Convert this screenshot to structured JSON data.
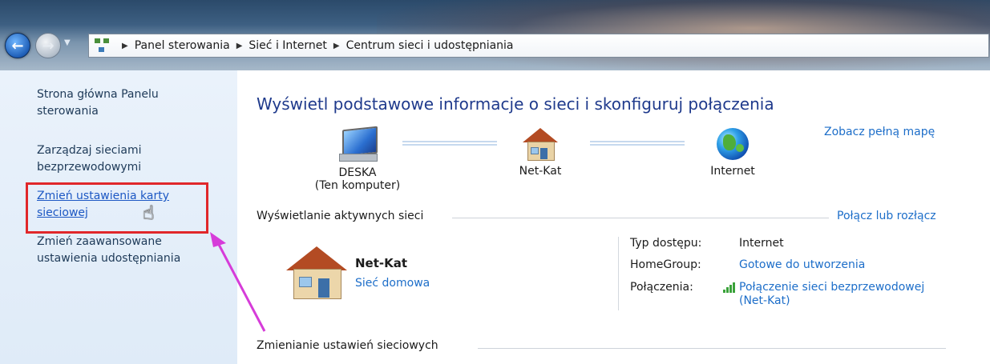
{
  "breadcrumb": [
    "Panel sterowania",
    "Sieć i Internet",
    "Centrum sieci i udostępniania"
  ],
  "left_pane": {
    "items": [
      {
        "label": "Strona główna Panelu sterowania"
      },
      {
        "label": "Zarządzaj sieciami bezprzewodowymi"
      },
      {
        "label": "Zmień ustawienia karty sieciowej"
      },
      {
        "label": "Zmień zaawansowane ustawienia udostępniania"
      }
    ]
  },
  "main": {
    "title": "Wyświetl podstawowe informacje o sieci i skonfiguruj połączenia",
    "full_map_link": "Zobacz pełną mapę",
    "nodes": {
      "computer": {
        "name": "DESKA",
        "subtitle": "(Ten komputer)"
      },
      "network": {
        "name": "Net-Kat"
      },
      "internet": {
        "name": "Internet"
      }
    },
    "active_networks_header": "Wyświetlanie aktywnych sieci",
    "connect_link": "Połącz lub rozłącz",
    "network": {
      "name": "Net-Kat",
      "type": "Sieć domowa"
    },
    "properties": {
      "access_type_label": "Typ dostępu:",
      "access_type_value": "Internet",
      "homegroup_label": "HomeGroup:",
      "homegroup_value": "Gotowe do utworzenia",
      "connections_label": "Połączenia:",
      "connections_value_line1": "Połączenie sieci bezprzewodowej",
      "connections_value_line2": "(Net-Kat)"
    },
    "change_settings_header": "Zmienianie ustawień sieciowych"
  },
  "colors": {
    "link": "#1d6ec9",
    "title": "#1f3a8c",
    "highlight": "#e0272a",
    "annotation_arrow": "#d63cd9"
  }
}
